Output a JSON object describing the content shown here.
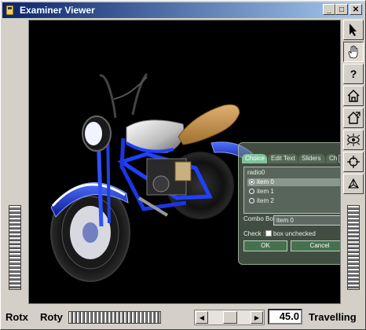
{
  "window": {
    "title": "Examiner Viewer",
    "min_glyph": "_",
    "max_glyph": "□",
    "close_glyph": "✕"
  },
  "tools": [
    {
      "name": "pick-arrow-icon"
    },
    {
      "name": "hand-icon"
    },
    {
      "name": "help-icon",
      "glyph": "?"
    },
    {
      "name": "home-icon"
    },
    {
      "name": "set-home-icon"
    },
    {
      "name": "view-all-eye-icon"
    },
    {
      "name": "seek-target-icon"
    },
    {
      "name": "projection-cube-icon"
    }
  ],
  "bottom": {
    "rotx_label": "Rotx",
    "roty_label": "Roty",
    "zoom_value": "45.0",
    "travelling_label": "Travelling",
    "left_arrow": "◀",
    "right_arrow": "▶"
  },
  "panel": {
    "tabs": [
      "Choice",
      "Edit Text",
      "Sliders",
      "Ch"
    ],
    "nav_left": "◀",
    "nav_right": "▶",
    "radio_group_label": "radio0",
    "radio_items": [
      {
        "label": "item 0",
        "selected": true
      },
      {
        "label": "item 1",
        "selected": false
      },
      {
        "label": "item 2",
        "selected": false
      }
    ],
    "combo_label": "Combo Box",
    "combo_value": "item 0",
    "combo_arrow": "▼",
    "check_label": "Check :",
    "check_text": "box unchecked",
    "ok_label": "OK",
    "cancel_label": "Cancel"
  }
}
